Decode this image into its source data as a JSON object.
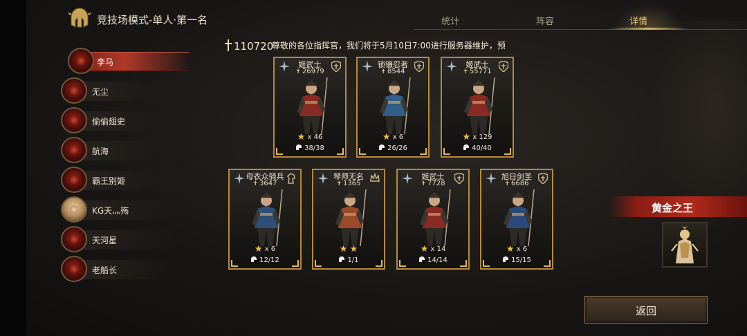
{
  "header": {
    "title": "竞技场模式-单人·第一名",
    "tabs": [
      {
        "label": "统计",
        "active": false
      },
      {
        "label": "阵容",
        "active": false
      },
      {
        "label": "详情",
        "active": true
      }
    ]
  },
  "players": [
    {
      "name": "李马",
      "selected": true,
      "avatar": "red-demon-avatar"
    },
    {
      "name": "无尘",
      "selected": false,
      "avatar": "red-demon-avatar"
    },
    {
      "name": "偷偷翅史",
      "selected": false,
      "avatar": "red-demon-avatar"
    },
    {
      "name": "航海",
      "selected": false,
      "avatar": "red-demon-avatar"
    },
    {
      "name": "霸王别姬",
      "selected": false,
      "avatar": "red-demon-avatar"
    },
    {
      "name": "KG天灬殇",
      "selected": false,
      "avatar": "portrait-avatar"
    },
    {
      "name": "天河星",
      "selected": false,
      "avatar": "red-demon-avatar"
    },
    {
      "name": "老船长",
      "selected": false,
      "avatar": "red-demon-avatar"
    }
  ],
  "power": {
    "value": "110720"
  },
  "notice": "尊敬的各位指挥官，我们将于5月10日7:00进行服务器维护，预",
  "units": [
    {
      "name": "姬武士",
      "power": "26979",
      "stars": "x 46",
      "count": "38/38",
      "color": "#8a2a24"
    },
    {
      "name": "锁镰忍者",
      "power": "8544",
      "stars": "x 6",
      "count": "26/26",
      "color": "#2f5f8a"
    },
    {
      "name": "姬武士",
      "power": "55771",
      "stars": "x 129",
      "count": "40/40",
      "color": "#8a2a24"
    },
    {
      "name": "母衣众骑兵",
      "power": "3647",
      "stars": "x 6",
      "count": "12/12",
      "color": "#2d4f7a"
    },
    {
      "name": "琴师无名",
      "power": "1365",
      "stars": "",
      "count": "1/1",
      "color": "#9a4a2a"
    },
    {
      "name": "姬武士",
      "power": "7728",
      "stars": "x 14",
      "count": "14/14",
      "color": "#8a2a24"
    },
    {
      "name": "旭日剑圣",
      "power": "6686",
      "stars": "x 6",
      "count": "15/15",
      "color": "#2a4a7a"
    }
  ],
  "reward": {
    "label": "黄金之王"
  },
  "back_button": {
    "label": "返回"
  },
  "colors": {
    "accent": "#e8c678",
    "selected_row": "#b0392a",
    "card_border": "#b48a3c",
    "star": "#f1c232"
  }
}
